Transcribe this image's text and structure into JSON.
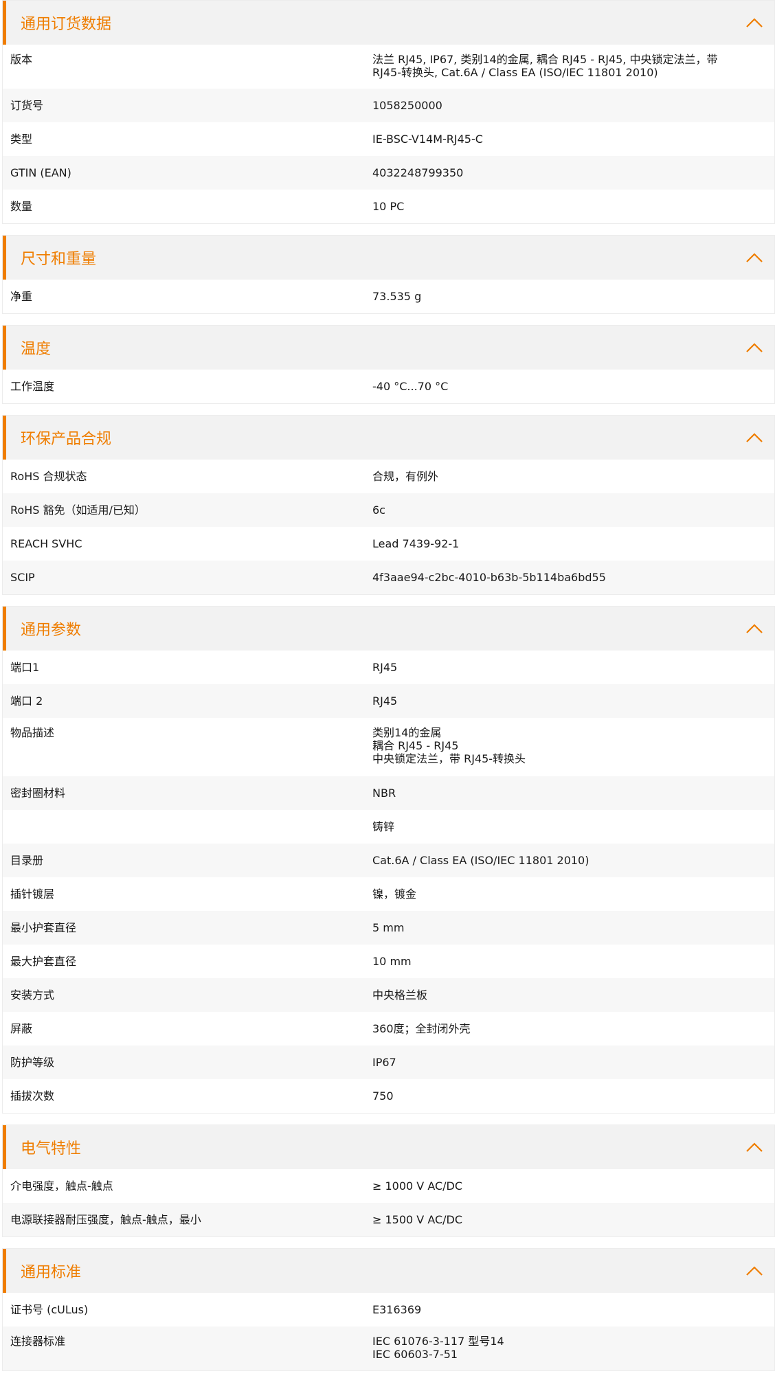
{
  "ui": {
    "accent": "#ef7d00",
    "header_bg": "#f2f2f2",
    "alt_row_bg": "#f7f7f7",
    "toggle_icon": "chevron-up-icon"
  },
  "sections": [
    {
      "title": "通用订货数据",
      "rows": [
        {
          "label": "版本",
          "value": [
            "法兰 RJ45, IP67, 类别14的金属, 耦合 RJ45 - RJ45, 中央锁定法兰，带",
            "RJ45-转换头, Cat.6A / Class EA (ISO/IEC 11801 2010)"
          ]
        },
        {
          "label": "订货号",
          "value": [
            "1058250000"
          ]
        },
        {
          "label": "类型",
          "value": [
            "IE-BSC-V14M-RJ45-C"
          ]
        },
        {
          "label": "GTIN (EAN)",
          "value": [
            "4032248799350"
          ]
        },
        {
          "label": "数量",
          "value": [
            "10  PC"
          ]
        }
      ]
    },
    {
      "title": "尺寸和重量",
      "rows": [
        {
          "label": "净重",
          "value": [
            "73.535  g"
          ]
        }
      ]
    },
    {
      "title": "温度",
      "rows": [
        {
          "label": "工作温度",
          "value": [
            "-40 °C...70 °C"
          ]
        }
      ]
    },
    {
      "title": "环保产品合规",
      "rows": [
        {
          "label": "RoHS 合规状态",
          "value": [
            "合规，有例外"
          ]
        },
        {
          "label": "RoHS 豁免（如适用/已知）",
          "value": [
            "6c"
          ]
        },
        {
          "label": "REACH SVHC",
          "value": [
            "Lead 7439-92-1"
          ]
        },
        {
          "label": "SCIP",
          "value": [
            "4f3aae94-c2bc-4010-b63b-5b114ba6bd55"
          ]
        }
      ]
    },
    {
      "title": "通用参数",
      "rows": [
        {
          "label": "端口1",
          "value": [
            "RJ45"
          ]
        },
        {
          "label": "端口 2",
          "value": [
            "RJ45"
          ]
        },
        {
          "label": "物品描述",
          "value": [
            "类别14的金属",
            "耦合 RJ45 - RJ45",
            "中央锁定法兰，带 RJ45-转换头"
          ]
        },
        {
          "label": "密封圈材料",
          "value": [
            "NBR"
          ]
        },
        {
          "label": "",
          "value": [
            "铸锌"
          ]
        },
        {
          "label": "目录册",
          "value": [
            "Cat.6A / Class EA (ISO/IEC 11801 2010)"
          ]
        },
        {
          "label": "插针镀层",
          "value": [
            "镍，镀金"
          ]
        },
        {
          "label": "最小护套直径",
          "value": [
            "5  mm"
          ]
        },
        {
          "label": "最大护套直径",
          "value": [
            "10  mm"
          ]
        },
        {
          "label": "安装方式",
          "value": [
            "中央格兰板"
          ]
        },
        {
          "label": "屏蔽",
          "value": [
            "360度；全封闭外壳"
          ]
        },
        {
          "label": "防护等级",
          "value": [
            "IP67"
          ]
        },
        {
          "label": "插拔次数",
          "value": [
            "750"
          ]
        }
      ]
    },
    {
      "title": "电气特性",
      "rows": [
        {
          "label": "介电强度，触点-触点",
          "value": [
            "≥ 1000 V AC/DC"
          ]
        },
        {
          "label": "电源联接器耐压强度，触点-触点，最小",
          "value": [
            "≥ 1500 V AC/DC"
          ]
        }
      ]
    },
    {
      "title": "通用标准",
      "rows": [
        {
          "label": "证书号 (cULus)",
          "value": [
            "E316369"
          ]
        },
        {
          "label": "连接器标准",
          "value": [
            "IEC 61076-3-117 型号14",
            "IEC 60603-7-51"
          ]
        }
      ]
    }
  ]
}
